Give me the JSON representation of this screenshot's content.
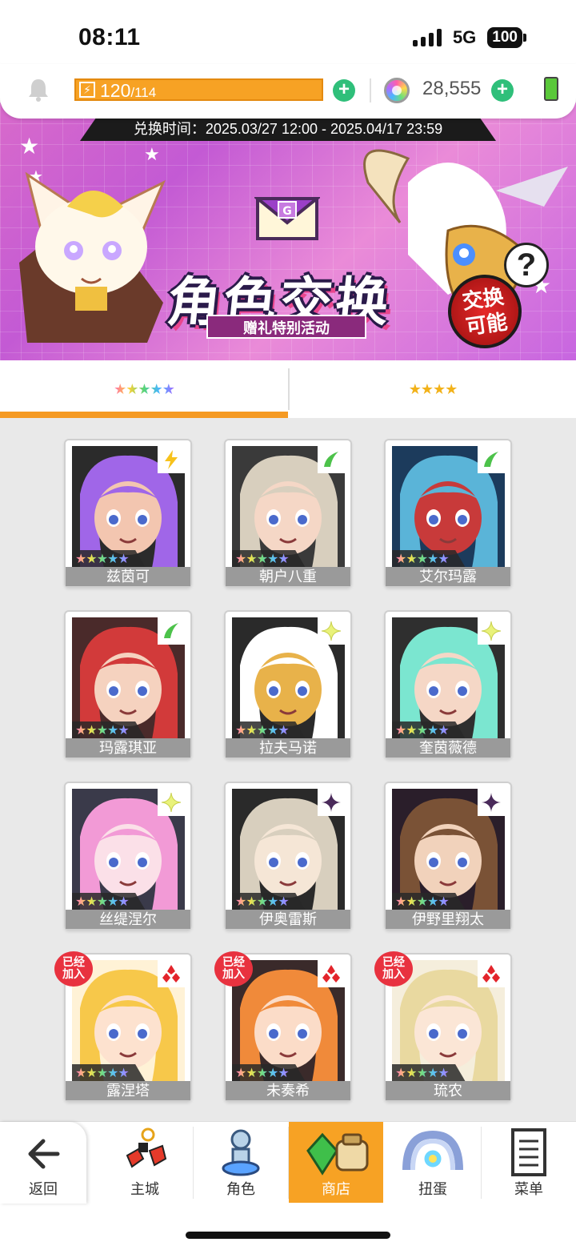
{
  "status_bar": {
    "time": "08:11",
    "network": "5G",
    "battery": "100"
  },
  "header": {
    "energy_current": "120",
    "energy_max": "/114",
    "gems": "28,555",
    "icons": {
      "notifications": "bell-icon",
      "energy": "lightning-icon",
      "gem": "rainbow-gem-icon",
      "add": "plus-icon",
      "battery": "battery-icon"
    }
  },
  "banner": {
    "period": "兑换时间：2025.03/27 12:00 - 2025.04/17 23:59",
    "title": "角色交换",
    "subtitle": "赠礼特别活动",
    "badge": "交换可能",
    "help": "?"
  },
  "tabs": [
    {
      "label": "★★★★★",
      "rarity": 5,
      "active": true
    },
    {
      "label": "★★★★",
      "rarity": 4,
      "active": false
    }
  ],
  "colors": {
    "accent": "#f59a23",
    "joined": "#e8323f",
    "plus": "#2fbf7a"
  },
  "characters": [
    {
      "name": "兹茵可",
      "stars": "★★★★★",
      "attribute": "lightning",
      "joined": ""
    },
    {
      "name": "朝户八重",
      "stars": "★★★★★",
      "attribute": "wind",
      "joined": ""
    },
    {
      "name": "艾尔玛露",
      "stars": "★★★★★",
      "attribute": "wind",
      "joined": ""
    },
    {
      "name": "玛露琪亚",
      "stars": "★★★★★",
      "attribute": "wind",
      "joined": ""
    },
    {
      "name": "拉夫马诺",
      "stars": "★★★★★",
      "attribute": "light",
      "joined": ""
    },
    {
      "name": "奎茵薇德",
      "stars": "★★★★★",
      "attribute": "light",
      "joined": ""
    },
    {
      "name": "丝缇涅尔",
      "stars": "★★★★★",
      "attribute": "light",
      "joined": ""
    },
    {
      "name": "伊奥雷斯",
      "stars": "★★★★★",
      "attribute": "dark",
      "joined": ""
    },
    {
      "name": "伊野里翔太",
      "stars": "★★★★★",
      "attribute": "dark",
      "joined": ""
    },
    {
      "name": "露涅塔",
      "stars": "★★★★★",
      "attribute": "fire",
      "joined": "已经加入"
    },
    {
      "name": "未奏希",
      "stars": "★★★★★",
      "attribute": "fire",
      "joined": "已经加入"
    },
    {
      "name": "琉农",
      "stars": "★★★★★",
      "attribute": "fire",
      "joined": "已经加入"
    }
  ],
  "bottom_nav": {
    "back": "返回",
    "items": [
      {
        "label": "主城",
        "icon": "town-icon"
      },
      {
        "label": "角色",
        "icon": "character-icon"
      },
      {
        "label": "商店",
        "icon": "shop-icon",
        "active": true
      },
      {
        "label": "扭蛋",
        "icon": "gacha-icon"
      },
      {
        "label": "菜单",
        "icon": "menu-icon"
      }
    ]
  }
}
